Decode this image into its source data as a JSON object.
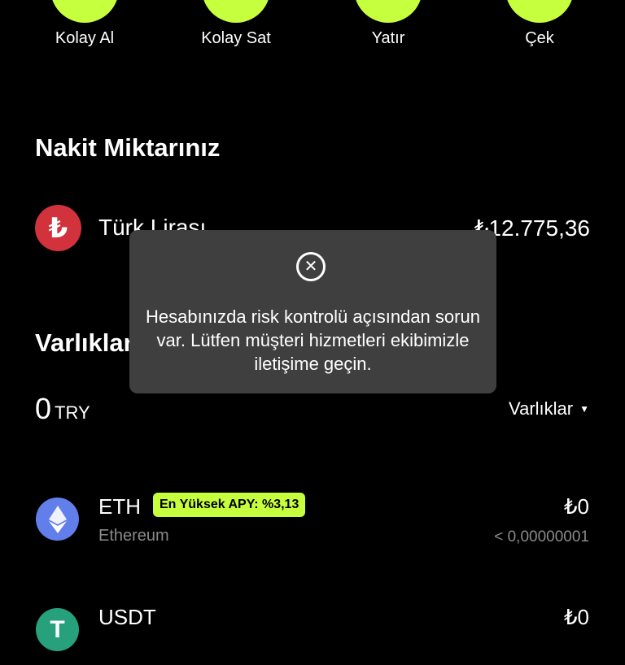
{
  "quick_actions": [
    "Kolay Al",
    "Kolay Sat",
    "Yatır",
    "Çek"
  ],
  "cash": {
    "title": "Nakit Miktarınız",
    "currency_icon": "₺",
    "currency_name": "Türk Lirası",
    "amount": "₺12.775,36"
  },
  "assets_section": {
    "title": "Varlıklar",
    "total_value": "0",
    "total_currency": "TRY",
    "filter_label": "Varlıklar"
  },
  "assets": [
    {
      "symbol": "ETH",
      "name": "Ethereum",
      "badge": "En Yüksek APY: %3,13",
      "value": "₺0",
      "sub_value": "< 0,00000001",
      "color": "#627eea"
    },
    {
      "symbol": "USDT",
      "value": "₺0",
      "color": "#26a17b"
    }
  ],
  "modal": {
    "message": "Hesabınızda risk kontrolü açısından sorun var. Lütfen müşteri hizmetleri ekibimizle iletişime geçin.",
    "close_icon": "close-circle-icon"
  }
}
